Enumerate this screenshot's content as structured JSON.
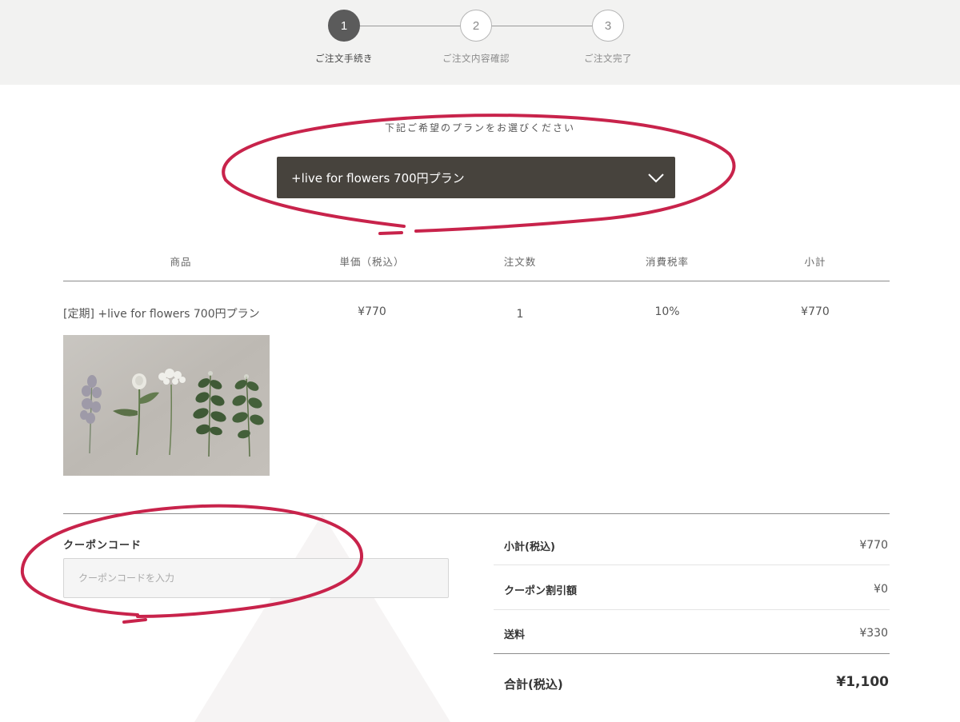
{
  "stepper": {
    "steps": [
      {
        "number": "1",
        "label": "ご注文手続き",
        "active": true
      },
      {
        "number": "2",
        "label": "ご注文内容確認",
        "active": false
      },
      {
        "number": "3",
        "label": "ご注文完了",
        "active": false
      }
    ]
  },
  "plan": {
    "prompt": "下記ご希望のプランをお選びください",
    "selected": "+live for flowers 700円プラン"
  },
  "table": {
    "headers": [
      "商品",
      "単価（税込）",
      "注文数",
      "消費税率",
      "小計"
    ],
    "rows": [
      {
        "name": "[定期] +live for flowers 700円プラン",
        "price": "¥770",
        "quantity": "1",
        "tax_rate": "10%",
        "subtotal": "¥770"
      }
    ]
  },
  "coupon": {
    "label": "クーポンコード",
    "placeholder": "クーポンコードを入力"
  },
  "summary": {
    "subtotal_label": "小計(税込)",
    "subtotal_value": "¥770",
    "discount_label": "クーポン割引額",
    "discount_value": "¥0",
    "shipping_label": "送料",
    "shipping_value": "¥330",
    "total_label": "合計(税込)",
    "total_value": "¥1,100"
  },
  "colors": {
    "header_bg": "#f2f2f1",
    "select_bg": "#47433d",
    "step_active": "#5b5b5b",
    "annotation": "#c8234b"
  },
  "icons": [
    "chevron-down-icon"
  ]
}
